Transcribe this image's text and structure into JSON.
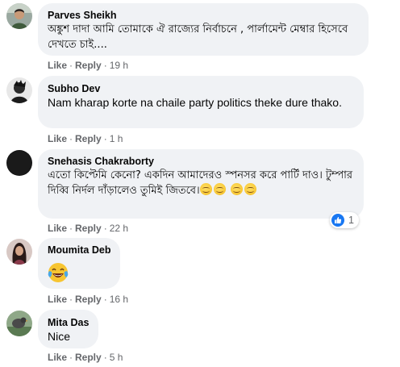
{
  "actions": {
    "like_label": "Like",
    "reply_label": "Reply",
    "separator": "·"
  },
  "comments": [
    {
      "author": "Parves Sheikh",
      "text": "অঙ্কুশ দাদা আমি তোমাকে ঐ রাজ্যের নির্বাচনে , পার্লামেন্ট মেম্বার হিসেবে দেখতে চাই....",
      "time": "19 h"
    },
    {
      "author": "Subho Dev",
      "text": "Nam kharap korte na chaile party politics theke dure thako.",
      "time": "1 h"
    },
    {
      "author": "Snehasis Chakraborty",
      "text": "এতো কিপ্টেমি কেনো? একদিন আমাদেরও স্পনসর করে পার্টি দাও। টুম্পার দিব্বি নির্দল দাঁড়ালেও তুমিই জিতবে।",
      "time": "22 h",
      "reaction_count": "1",
      "reaction_icon": "like-icon"
    },
    {
      "author": "Moumita Deb",
      "text": "",
      "emoji": "laughing-crying-icon",
      "time": "16 h"
    },
    {
      "author": "Mita Das",
      "text": "Nice",
      "time": "5 h"
    }
  ],
  "colors": {
    "bubble_bg": "#f0f2f5",
    "meta_text": "#65676b",
    "like_blue": "#1877f2",
    "name_text": "#050505"
  }
}
